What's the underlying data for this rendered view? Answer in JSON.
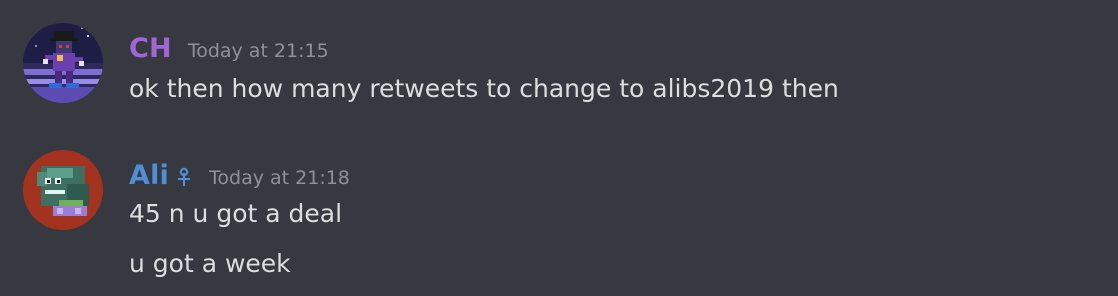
{
  "messages": [
    {
      "username": "CH",
      "username_color": "#a364d6",
      "timestamp": "Today at 21:15",
      "lines": [
        "ok then how many retweets to change to alibs2019 then"
      ]
    },
    {
      "username": "Ali",
      "username_color": "#4f8fd6",
      "role_icon": "sprout-icon",
      "timestamp": "Today at 21:18",
      "lines": [
        "45 n u got a deal",
        "u got a week"
      ]
    }
  ]
}
